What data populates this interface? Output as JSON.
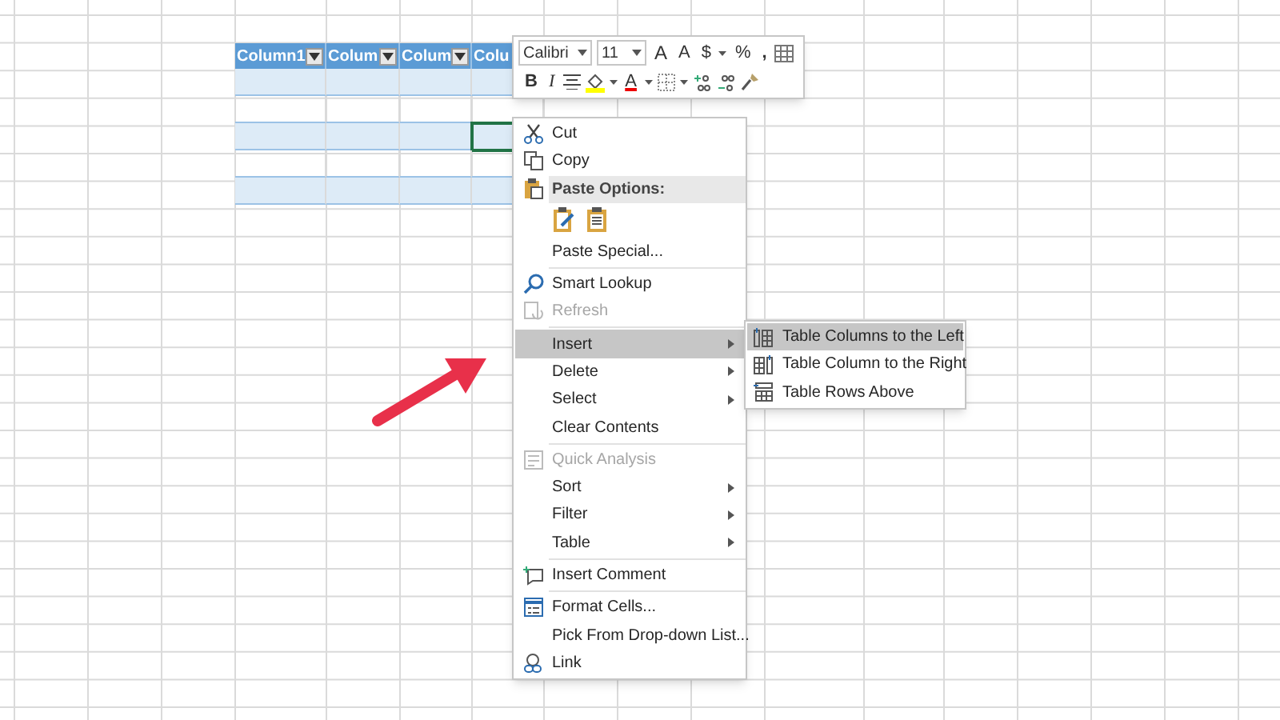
{
  "table": {
    "columns": [
      {
        "label": "Column1",
        "filter_button": true
      },
      {
        "label": "Colum",
        "filter_button": true
      },
      {
        "label": "Colum",
        "filter_button": true
      },
      {
        "label": "Colu"
      }
    ],
    "rows": [
      {
        "banded": true,
        "cells": [
          {
            "selected": false
          },
          {
            "selected": false
          },
          {
            "selected": false
          },
          {
            "selected": false
          }
        ]
      },
      {
        "banded": false,
        "cells": [
          {
            "selected": false
          },
          {
            "selected": false
          },
          {
            "selected": false
          },
          {
            "selected": false
          }
        ]
      },
      {
        "banded": true,
        "cells": [
          {
            "selected": false
          },
          {
            "selected": false
          },
          {
            "selected": false
          },
          {
            "selected": true
          }
        ]
      },
      {
        "banded": false,
        "cells": [
          {
            "selected": false
          },
          {
            "selected": false
          },
          {
            "selected": false
          },
          {
            "selected": false
          }
        ]
      },
      {
        "banded": true,
        "cells": [
          {
            "selected": false
          },
          {
            "selected": false
          },
          {
            "selected": false
          },
          {
            "selected": false
          }
        ]
      }
    ]
  },
  "mini_toolbar": {
    "font_name": "Calibri",
    "font_size": "11",
    "row_1": [
      {
        "kind": "text",
        "label": "A"
      },
      {
        "kind": "text",
        "label": "A"
      },
      {
        "kind": "text",
        "label": "$",
        "dropdown": true
      },
      {
        "kind": "text",
        "label": "%"
      },
      {
        "kind": "text",
        "label": ","
      },
      {
        "kind": "icon"
      }
    ],
    "row_2": [
      {
        "kind": "text",
        "label": "B"
      },
      {
        "kind": "text",
        "label": "I"
      },
      {
        "kind": "icon"
      },
      {
        "kind": "icon",
        "dropdown": true
      },
      {
        "kind": "text",
        "label": "A",
        "dropdown": true
      },
      {
        "kind": "icon",
        "dropdown": true
      },
      {
        "kind": "icon"
      },
      {
        "kind": "icon"
      },
      {
        "kind": "icon"
      }
    ]
  },
  "context_menu": [
    {
      "kind": "item",
      "label": "Cut",
      "disabled": false,
      "submenu": false,
      "selected": false
    },
    {
      "kind": "item",
      "label": "Copy",
      "disabled": false,
      "submenu": false,
      "selected": false
    },
    {
      "kind": "header",
      "label": "Paste Options:"
    },
    {
      "kind": "paste_options"
    },
    {
      "kind": "item",
      "label": "Paste Special...",
      "disabled": false,
      "submenu": false,
      "selected": false
    },
    {
      "kind": "separator"
    },
    {
      "kind": "item",
      "label": "Smart Lookup",
      "disabled": false,
      "submenu": false,
      "selected": false
    },
    {
      "kind": "item",
      "label": "Refresh",
      "disabled": true,
      "submenu": false,
      "selected": false
    },
    {
      "kind": "separator"
    },
    {
      "kind": "item",
      "label": "Insert",
      "disabled": false,
      "submenu": true,
      "selected": true
    },
    {
      "kind": "item",
      "label": "Delete",
      "disabled": false,
      "submenu": true,
      "selected": false
    },
    {
      "kind": "item",
      "label": "Select",
      "disabled": false,
      "submenu": true,
      "selected": false
    },
    {
      "kind": "item",
      "label": "Clear Contents",
      "disabled": false,
      "submenu": false,
      "selected": false
    },
    {
      "kind": "separator"
    },
    {
      "kind": "item",
      "label": "Quick Analysis",
      "disabled": true,
      "submenu": false,
      "selected": false
    },
    {
      "kind": "item",
      "label": "Sort",
      "disabled": false,
      "submenu": true,
      "selected": false
    },
    {
      "kind": "item",
      "label": "Filter",
      "disabled": false,
      "submenu": true,
      "selected": false
    },
    {
      "kind": "item",
      "label": "Table",
      "disabled": false,
      "submenu": true,
      "selected": false
    },
    {
      "kind": "separator"
    },
    {
      "kind": "item",
      "label": "Insert Comment",
      "disabled": false,
      "submenu": false,
      "selected": false
    },
    {
      "kind": "separator"
    },
    {
      "kind": "item",
      "label": "Format Cells...",
      "disabled": false,
      "submenu": false,
      "selected": false
    },
    {
      "kind": "item",
      "label": "Pick From Drop-down List...",
      "disabled": false,
      "submenu": false,
      "selected": false
    },
    {
      "kind": "item",
      "label": "Link",
      "disabled": false,
      "submenu": false,
      "selected": false
    }
  ],
  "submenu": [
    {
      "label": "Table Columns to the Left",
      "selected": true
    },
    {
      "label": "Table Column to the Right",
      "selected": false
    },
    {
      "label": "Table Rows Above",
      "selected": false
    }
  ]
}
